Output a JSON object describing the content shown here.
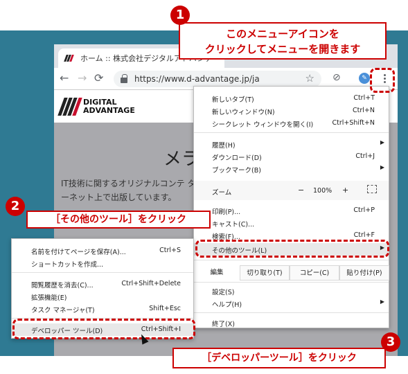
{
  "browser": {
    "tab_title": "ホーム :: 株式会社デジタルアドバンテ",
    "url": "https://www.d-advantage.jp/ja"
  },
  "page": {
    "logo_line1": "DIGITAL",
    "logo_line2": "ADVANTAGE",
    "heading": "メラ",
    "text": "IT技術に関するオリジナルコンテ ターネット上で出版しています。"
  },
  "menu": {
    "new_tab": {
      "label": "新しいタブ(T)",
      "shortcut": "Ctrl+T"
    },
    "new_window": {
      "label": "新しいウィンドウ(N)",
      "shortcut": "Ctrl+N"
    },
    "incognito": {
      "label": "シークレット ウィンドウを開く(I)",
      "shortcut": "Ctrl+Shift+N"
    },
    "history": {
      "label": "履歴(H)"
    },
    "downloads": {
      "label": "ダウンロード(D)",
      "shortcut": "Ctrl+J"
    },
    "bookmarks": {
      "label": "ブックマーク(B)"
    },
    "zoom": {
      "label": "ズーム",
      "minus": "−",
      "value": "100%",
      "plus": "+"
    },
    "print": {
      "label": "印刷(P)...",
      "shortcut": "Ctrl+P"
    },
    "cast": {
      "label": "キャスト(C)..."
    },
    "find": {
      "label": "検索(F)...",
      "shortcut": "Ctrl+F"
    },
    "more_tools": {
      "label": "その他のツール(L)"
    },
    "edit": {
      "label": "編集",
      "cut": "切り取り(T)",
      "copy": "コピー(C)",
      "paste": "貼り付け(P)"
    },
    "settings": {
      "label": "設定(S)"
    },
    "help": {
      "label": "ヘルプ(H)"
    },
    "exit": {
      "label": "終了(X)"
    }
  },
  "submenu": {
    "save_page": {
      "label": "名前を付けてページを保存(A)...",
      "shortcut": "Ctrl+S"
    },
    "create_shortcut": {
      "label": "ショートカットを作成..."
    },
    "clear_history": {
      "label": "閲覧履歴を消去(C)...",
      "shortcut": "Ctrl+Shift+Delete"
    },
    "extensions": {
      "label": "拡張機能(E)"
    },
    "task_manager": {
      "label": "タスク マネージャ(T)",
      "shortcut": "Shift+Esc"
    },
    "dev_tools": {
      "label": "デベロッパー ツール(D)",
      "shortcut": "Ctrl+Shift+I"
    }
  },
  "callouts": {
    "step1_number": "1",
    "step1_text_line1": "このメニューアイコンを",
    "step1_text_line2": "クリックしてメニューを開きます",
    "step2_number": "2",
    "step2_text": "［その他のツール］をクリック",
    "step3_number": "3",
    "step3_text": "［デベロッパーツール］をクリック"
  },
  "colors": {
    "accent": "#cc0000",
    "background": "#2f7a93"
  }
}
